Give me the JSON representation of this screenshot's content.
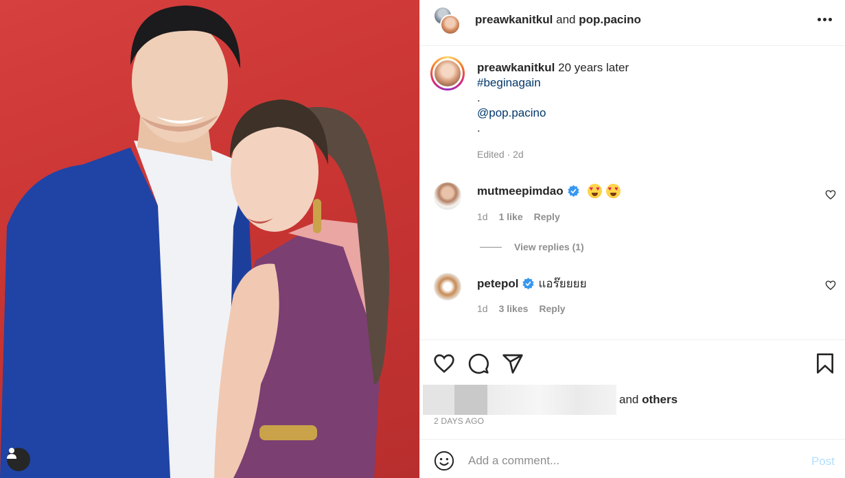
{
  "header": {
    "user1": "preawkanitkul",
    "conj": "and",
    "user2": "pop.pacino"
  },
  "caption": {
    "username": "preawkanitkul",
    "text": "20 years later",
    "hashtag": "#beginagain",
    "dot1": ".",
    "mention": "@pop.pacino",
    "dot2": ".",
    "meta": "Edited · 2d"
  },
  "comments": [
    {
      "username": "mutmeepimdao",
      "verified": true,
      "text": "",
      "emojis": [
        "heart-eyes-emoji",
        "heart-eyes-emoji"
      ],
      "age": "1d",
      "likes": "1 like",
      "reply": "Reply",
      "view_replies": "View replies (1)"
    },
    {
      "username": "petepol",
      "verified": true,
      "text": "แอร๊ยยยย",
      "age": "1d",
      "likes": "3 likes",
      "reply": "Reply"
    }
  ],
  "actions": {
    "icons": [
      "heart-icon",
      "comment-icon",
      "share-icon",
      "bookmark-icon"
    ],
    "likes_suffix_and": "and",
    "likes_suffix_others": "others",
    "timestamp": "2 DAYS AGO"
  },
  "add_comment": {
    "placeholder": "Add a comment...",
    "post_label": "Post",
    "post_color": "#b2dffc"
  },
  "colors": {
    "link": "#00376b",
    "muted": "#8e8e8e",
    "verified": "#3897f0",
    "photo_background": "#c93533"
  }
}
